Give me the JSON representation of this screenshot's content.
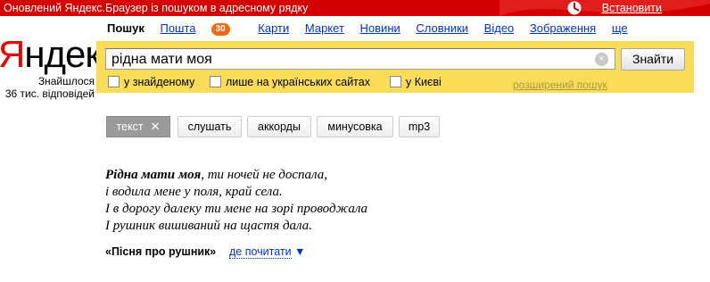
{
  "promo": {
    "text": "Оновлений Яндекс.Браузер із пошуком в адресному рядку",
    "install_label": "Встановити"
  },
  "logo": {
    "first_letter": "Я",
    "rest": "ндекс"
  },
  "results_count": {
    "line1": "Знайшлося",
    "line2": "36 тис. відповідей"
  },
  "services": [
    {
      "label": "Пошук",
      "active": true
    },
    {
      "label": "Пошта",
      "badge": "30"
    },
    {
      "label": "Карти"
    },
    {
      "label": "Маркет"
    },
    {
      "label": "Новини"
    },
    {
      "label": "Словники"
    },
    {
      "label": "Відео"
    },
    {
      "label": "Зображення"
    },
    {
      "label": "ще"
    }
  ],
  "search": {
    "query": "рідна мати моя",
    "clear_symbol": "×",
    "submit_label": "Знайти",
    "options": [
      "у знайденому",
      "лише на українських сайтах",
      "у Києві"
    ],
    "advanced_label": "розширений пошук"
  },
  "tabs": [
    {
      "label": "текст",
      "active": true,
      "close": "✕"
    },
    {
      "label": "слушать"
    },
    {
      "label": "аккорды"
    },
    {
      "label": "минусовка"
    },
    {
      "label": "mp3"
    }
  ],
  "lyrics": {
    "first_bold": "Рідна мати моя",
    "first_rest": ", ти ночей не доспала,",
    "line2": "і водила мене у поля, край села.",
    "line3": "І в дорогу далеку ти мене на зорі проводжала",
    "line4": "І рушник вишиваний на щастя дала."
  },
  "song": {
    "title": "«Пісня про рушник»",
    "more_label": "де почитати",
    "more_arrow": "▼"
  },
  "colors": {
    "promo_bg": "#d40000",
    "search_band": "#f9dc57",
    "logo_red": "#ee0000",
    "link": "#0033cc",
    "badge": "#f06a0f"
  }
}
